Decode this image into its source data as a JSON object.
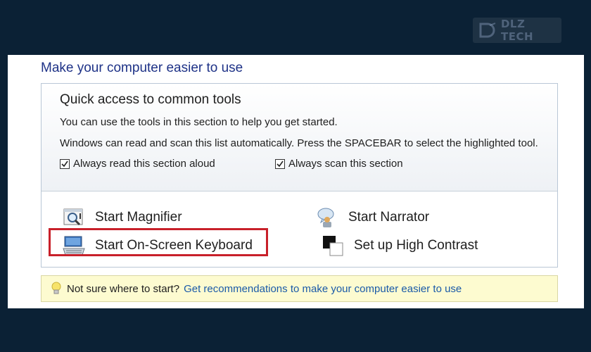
{
  "watermark": {
    "text": "DLZ TECH"
  },
  "window": {
    "title": "Make your computer easier to use"
  },
  "quick_access": {
    "title": "Quick access to common tools",
    "line1": "You can use the tools in this section to help you get started.",
    "line2": "Windows can read and scan this list automatically.  Press the SPACEBAR to select the highlighted tool.",
    "checkboxes": [
      {
        "label": "Always read this section aloud",
        "checked": true
      },
      {
        "label": "Always scan this section",
        "checked": true
      }
    ]
  },
  "tools": [
    {
      "label": "Start Magnifier",
      "icon": "magnifier-icon"
    },
    {
      "label": "Start Narrator",
      "icon": "narrator-icon"
    },
    {
      "label": "Start On-Screen Keyboard",
      "icon": "keyboard-icon",
      "highlighted": true
    },
    {
      "label": "Set up High Contrast",
      "icon": "high-contrast-icon"
    }
  ],
  "tip": {
    "icon": "lightbulb-icon",
    "text": "Not sure where to start?",
    "link": "Get recommendations to make your computer easier to use"
  },
  "colors": {
    "background": "#0b2135",
    "title": "#1e3287",
    "link": "#1a5aa8",
    "highlight_border": "#c8202a",
    "tip_background": "#fdfbd0"
  }
}
